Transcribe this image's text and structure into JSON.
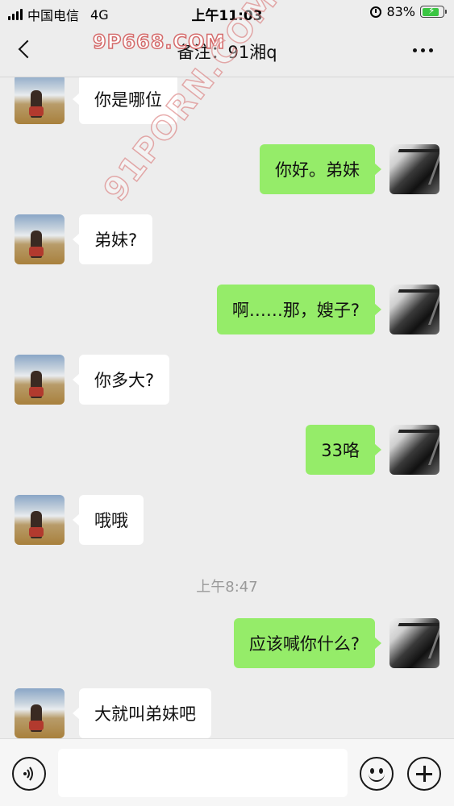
{
  "status_bar": {
    "carrier": "中国电信",
    "network": "4G",
    "time": "上午11:03",
    "battery_percent": "83%",
    "battery_level": 0.83,
    "icons": [
      "signal-icon",
      "alarm-icon",
      "battery-charging-icon"
    ]
  },
  "nav": {
    "title": "备注：91湘q",
    "back_icon": "chevron-left-icon",
    "more_icon": "more-dots-icon"
  },
  "watermarks": {
    "top": "9P668.COM",
    "diagonal": "91PORN.COM"
  },
  "messages": [
    {
      "side": "left",
      "text": "你是哪位"
    },
    {
      "side": "right",
      "text": "你好。弟妹"
    },
    {
      "side": "left",
      "text": "弟妹?"
    },
    {
      "side": "right",
      "text": "啊……那，嫂子?"
    },
    {
      "side": "left",
      "text": "你多大?"
    },
    {
      "side": "right",
      "text": "33咯"
    },
    {
      "side": "left",
      "text": "哦哦"
    },
    {
      "side": "right",
      "text": "应该喊你什么?"
    },
    {
      "side": "left",
      "text": "大就叫弟妹吧"
    }
  ],
  "timestamp": "上午8:47",
  "input_bar": {
    "placeholder": "",
    "icons": [
      "voice-icon",
      "emoji-icon",
      "plus-icon"
    ]
  },
  "colors": {
    "background": "#ededed",
    "bubble_sent": "#95ec69",
    "bubble_received": "#ffffff",
    "battery_charging": "#3ac642"
  }
}
